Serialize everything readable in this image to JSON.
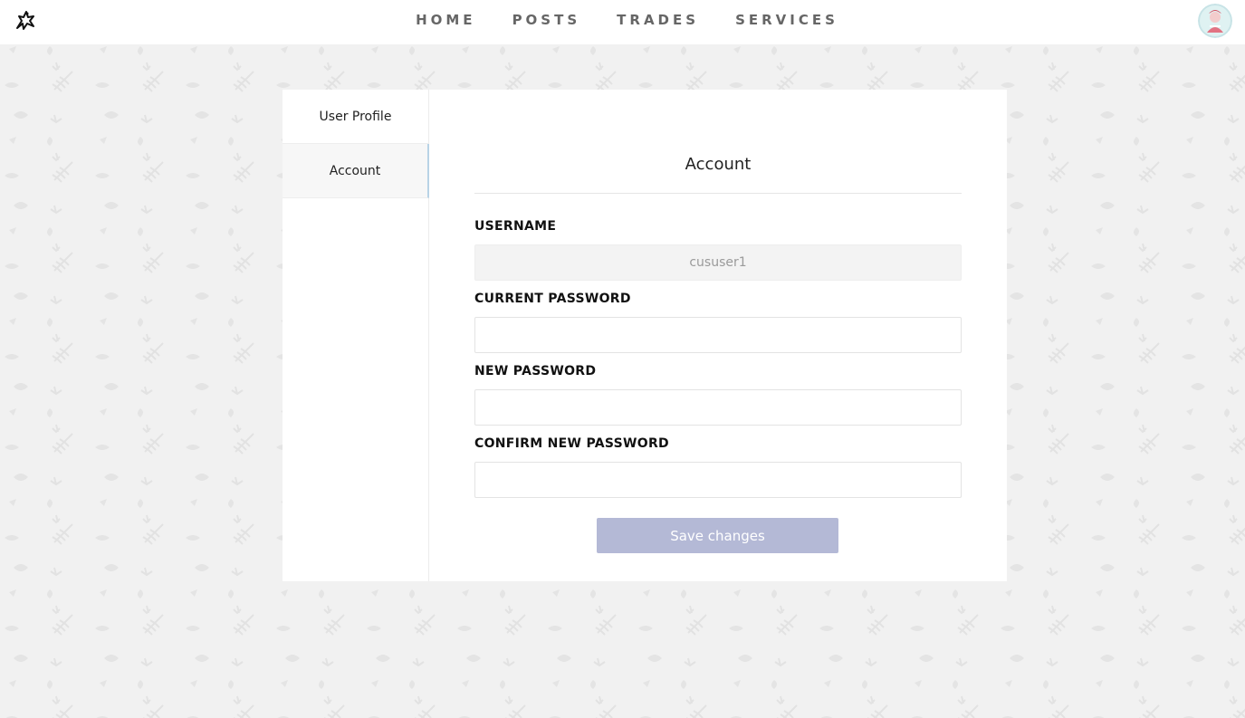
{
  "nav": {
    "items": [
      "HOME",
      "POSTS",
      "TRADES",
      "SERVICES"
    ]
  },
  "icons": {
    "logo": "horse-star-icon",
    "avatar": "user-avatar"
  },
  "sidebar": {
    "items": [
      {
        "label": "User Profile",
        "active": false
      },
      {
        "label": "Account",
        "active": true
      }
    ]
  },
  "account": {
    "title": "Account",
    "username_label": "USERNAME",
    "username_value": "cususer1",
    "current_password_label": "CURRENT PASSWORD",
    "current_password_value": "",
    "new_password_label": "NEW PASSWORD",
    "new_password_value": "",
    "confirm_password_label": "CONFIRM NEW PASSWORD",
    "confirm_password_value": "",
    "save_label": "Save changes"
  },
  "colors": {
    "page_bg": "#f1f1f1",
    "save_button": "#b4b9d6",
    "active_tab_border": "#b8d3e6"
  }
}
